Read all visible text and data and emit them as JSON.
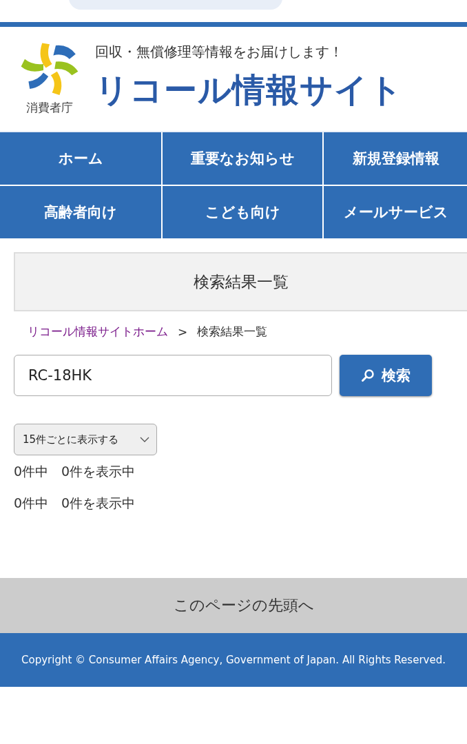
{
  "header": {
    "logo_text": "消費者庁",
    "tagline": "回収・無償修理等情報をお届けします！",
    "site_title": "リコール情報サイト"
  },
  "nav": [
    {
      "label": "ホーム"
    },
    {
      "label": "重要なお知らせ"
    },
    {
      "label": "新規登録情報"
    },
    {
      "label": "高齢者向け"
    },
    {
      "label": "こども向け"
    },
    {
      "label": "メールサービス"
    }
  ],
  "page_heading": "検索結果一覧",
  "breadcrumb": [
    {
      "label": "リコール情報サイトホーム",
      "kind": "link"
    },
    {
      "label": "検索結果一覧",
      "kind": "current"
    }
  ],
  "breadcrumb_separator": ">",
  "search": {
    "value": "RC-18HK",
    "button": "検索"
  },
  "per_page": {
    "value": "15件ごとに表示する"
  },
  "result_counts": [
    "0件中　0件を表示中",
    "0件中　0件を表示中"
  ],
  "back_to_top": "このページの先頭へ",
  "copyright": "Copyright © Consumer Affairs Agency, Government of Japan. All Rights Reserved."
}
